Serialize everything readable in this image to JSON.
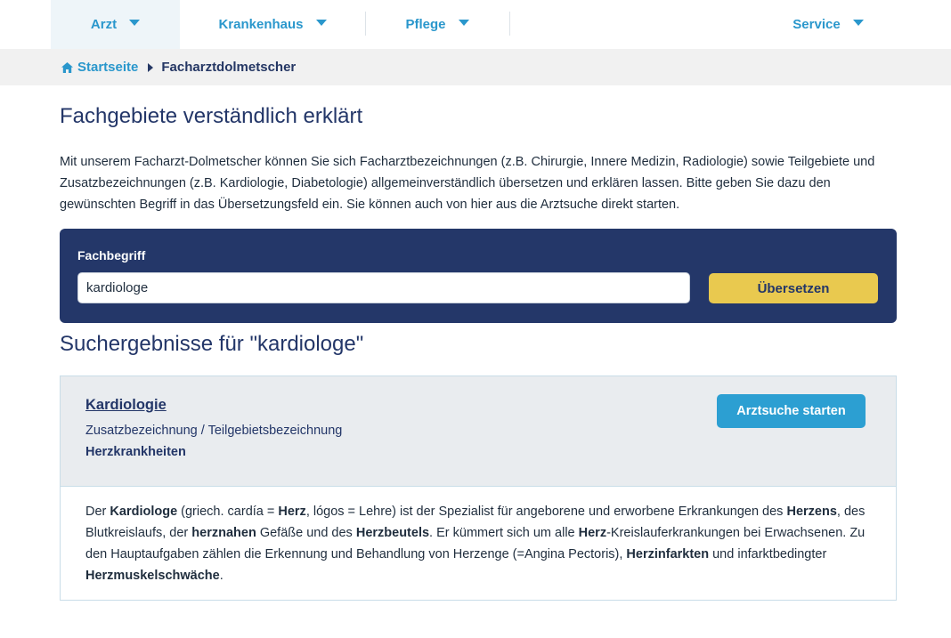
{
  "nav": {
    "arzt": "Arzt",
    "krankenhaus": "Krankenhaus",
    "pflege": "Pflege",
    "service": "Service"
  },
  "breadcrumb": {
    "home": "Startseite",
    "current": "Facharztdolmetscher"
  },
  "page": {
    "title": "Fachgebiete verständlich erklärt",
    "intro": "Mit unserem Facharzt-Dolmetscher können Sie sich Facharztbezeichnungen (z.B. Chirurgie, Innere Medizin, Radiologie) sowie Teilgebiete und Zusatzbezeichnungen (z.B. Kardiologie, Diabetologie) allgemeinverständlich übersetzen und erklären lassen. Bitte geben Sie dazu den gewünschten Begriff in das Übersetzungsfeld ein. Sie können auch von hier aus die Arztsuche direkt starten."
  },
  "search": {
    "label": "Fachbegriff",
    "value": "kardiologe",
    "button": "Übersetzen"
  },
  "results": {
    "title": "Suchergebnisse für \"kardiologe\"",
    "items": [
      {
        "name": "Kardiologie",
        "type": "Zusatzbezeichnung / Teilgebietsbezeichnung",
        "area": "Herzkrankheiten",
        "button": "Arztsuche starten",
        "description": [
          {
            "text": "Der ",
            "bold": false
          },
          {
            "text": "Kardiologe",
            "bold": true
          },
          {
            "text": " (griech. cardía = ",
            "bold": false
          },
          {
            "text": "Herz",
            "bold": true
          },
          {
            "text": ", lógos = Lehre) ist der Spezialist für angeborene und erworbene Erkrankungen des ",
            "bold": false
          },
          {
            "text": "Herzens",
            "bold": true
          },
          {
            "text": ", des Blutkreislaufs, der ",
            "bold": false
          },
          {
            "text": "herznahen",
            "bold": true
          },
          {
            "text": " Gefäße und des ",
            "bold": false
          },
          {
            "text": "Herzbeutels",
            "bold": true
          },
          {
            "text": ". Er kümmert sich um alle ",
            "bold": false
          },
          {
            "text": "Herz",
            "bold": true
          },
          {
            "text": "-Kreislauferkrankungen bei Erwachsenen. Zu den Hauptaufgaben zählen die Erkennung und Behandlung von Herzenge (=Angina Pectoris), ",
            "bold": false
          },
          {
            "text": "Herzinfarkten",
            "bold": true
          },
          {
            "text": " und infarktbedingter ",
            "bold": false
          },
          {
            "text": "Herzmuskelschwäche",
            "bold": true
          },
          {
            "text": ".",
            "bold": false
          }
        ]
      }
    ]
  },
  "icons": {
    "home": "home-icon",
    "nav_caret": "caret-down-icon",
    "breadcrumb_separator": "chevron-right-icon"
  },
  "colors": {
    "accent": "#2a97cc",
    "navy": "#243769",
    "button_yellow": "#e9c94f",
    "button_blue": "#2c9fd2"
  }
}
